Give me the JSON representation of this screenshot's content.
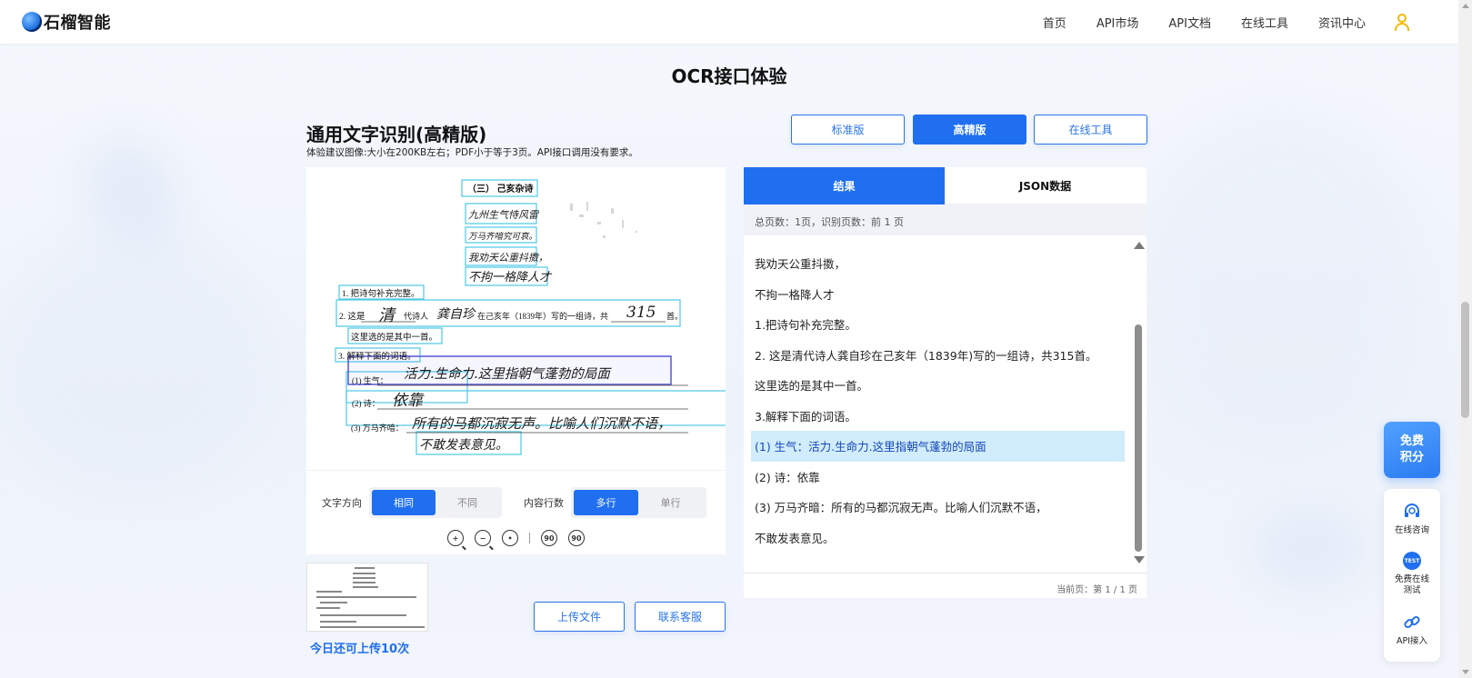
{
  "header": {
    "logo_text": "石榴智能",
    "nav": [
      "首页",
      "API市场",
      "API文档",
      "在线工具",
      "资讯中心"
    ]
  },
  "page_title": "OCR接口体验",
  "section": {
    "title": "通用文字识别(高精版)",
    "subtitle": "体验建议图像:大小在200KB左右；PDF小于等于3页。API接口调用没有要求。"
  },
  "version_buttons": {
    "standard": "标准版",
    "high": "高精版",
    "online_tool": "在线工具"
  },
  "document": {
    "lines": [
      "（三）  己亥杂诗",
      "九州生气恃风雷",
      "万马齐喑究可哀。",
      "我劝天公重抖擞，",
      "不拘一格降人才",
      "1. 把诗句补充完整。",
      "2. 这是",
      "清",
      "代诗人",
      "龚自珍",
      "在己亥年（1839年）写的一组诗，共",
      "315",
      "首。",
      "这里选的是其中一首。",
      "3. 解释下面的词语。",
      "(1) 生气：",
      "活力.生命力.这里指朝气蓬勃的局面",
      "(2) 诗：",
      "依靠",
      "(3) 万马齐喑：",
      "所有的马都沉寂无声。比喻人们沉默不语，",
      "不敢发表意见。"
    ]
  },
  "controls": {
    "direction_label": "文字方向",
    "direction_options": [
      "相同",
      "不同"
    ],
    "lines_label": "内容行数",
    "lines_options": [
      "多行",
      "单行"
    ],
    "rotate_left": "90",
    "rotate_right": "90"
  },
  "actions": {
    "upload": "上传文件",
    "contact": "联系客服",
    "quota": "今日还可上传10次"
  },
  "result_panel": {
    "tabs": [
      "结果",
      "JSON数据"
    ],
    "page_info": "总页数：1页，识别页数：前 1 页",
    "lines": [
      "我劝天公重抖擞，",
      "不拘一格降人才",
      "1.把诗句补充完整。",
      "2. 这是清代诗人龚自珍在己亥年（1839年)写的一组诗，共315首。",
      "这里选的是其中一首。",
      "3.解释下面的词语。",
      "(1) 生气：活力.生命力.这里指朝气蓬勃的局面",
      "(2) 诗：依靠",
      "(3) 万马齐暗：所有的马都沉寂无声。比喻人们沉默不语，",
      "不敢发表意见。"
    ],
    "highlight_index": 6,
    "current_page": "当前页：第 1 / 1 页"
  },
  "floating": {
    "free_points": [
      "免费",
      "积分"
    ],
    "online_consult": "在线咨询",
    "free_test": [
      "免费在线",
      "测试"
    ],
    "test_badge": "TEST",
    "api_access": "API接入"
  },
  "colors": {
    "primary": "#1f6ff0",
    "highlight_bg": "#d1ecfb",
    "ocr_box": "#4ec9e6",
    "user_icon": "#f5b800"
  }
}
